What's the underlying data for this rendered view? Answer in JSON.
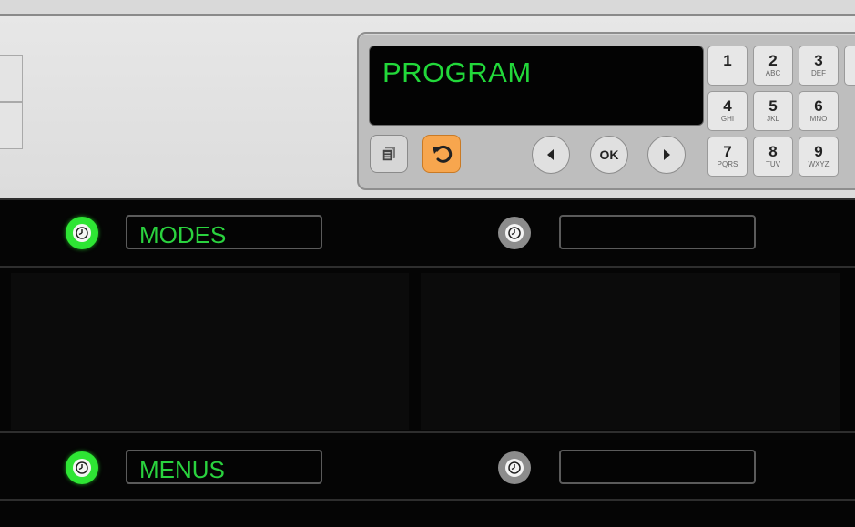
{
  "display": {
    "text": "PROGRAM"
  },
  "controls": {
    "ok_label": "OK"
  },
  "keypad": [
    {
      "num": "1",
      "letters": ""
    },
    {
      "num": "2",
      "letters": "ABC"
    },
    {
      "num": "3",
      "letters": "DEF"
    },
    {
      "num": "4",
      "letters": "GHI"
    },
    {
      "num": "5",
      "letters": "JKL"
    },
    {
      "num": "6",
      "letters": "MNO"
    },
    {
      "num": "7",
      "letters": "PQRS"
    },
    {
      "num": "8",
      "letters": "TUV"
    },
    {
      "num": "9",
      "letters": "WXYZ"
    }
  ],
  "rows": [
    {
      "left_label": "MODES",
      "right_label": ""
    },
    {
      "left_label": "MENUS",
      "right_label": ""
    }
  ],
  "colors": {
    "lcd_text": "#22d83a",
    "indicator_on": "#2ee534",
    "indicator_off": "#8c8c8c",
    "undo_button": "#f7a64e"
  },
  "icons": {
    "copy": "copy-icon",
    "undo": "undo-icon",
    "left": "arrow-left-icon",
    "right": "arrow-right-icon",
    "indicator": "clock-icon"
  }
}
